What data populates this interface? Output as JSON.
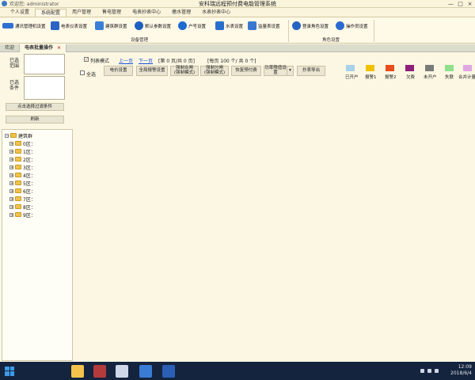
{
  "window": {
    "title": "安科瑞远程预付费电能管理系统",
    "welcome": "欢迎您: administrator",
    "controls": [
      "—",
      "□",
      "×"
    ]
  },
  "menu": {
    "tabs": [
      "个人设置",
      "系统配置",
      "用户管理",
      "售电管理",
      "电表抄表中心",
      "缴水管理",
      "水表抄表中心"
    ],
    "active_index": 1
  },
  "ribbon": {
    "items": [
      {
        "label": "通讯管理机设置",
        "icon": "gateway-icon",
        "color": "#2f6fd1"
      },
      {
        "label": "电表仪表设置",
        "icon": "meter-icon",
        "color": "#2a63c4"
      },
      {
        "label": "建筑群设置",
        "icon": "building-icon",
        "color": "#3b7fd6"
      },
      {
        "label": "默认参数设置",
        "icon": "gear-icon",
        "color": "#1f5fbf"
      },
      {
        "label": "户号设置",
        "icon": "household-icon",
        "color": "#1e6bd1"
      },
      {
        "label": "水表设置",
        "icon": "water-meter-icon",
        "color": "#2a6ecc"
      },
      {
        "label": "监量表设置",
        "icon": "monitor-icon",
        "color": "#3a78d0"
      },
      {
        "label": "登录角色设置",
        "icon": "user-role-icon",
        "color": "#2563c2"
      },
      {
        "label": "操作员设置",
        "icon": "operator-icon",
        "color": "#2b6bd0"
      }
    ],
    "groups": [
      "设备管理",
      "角色设置"
    ]
  },
  "filter_panel": {
    "selected_scope_label": "已选范围",
    "selected_conditions_label": "已选条件",
    "select_filter_button": "点击选择过滤条件",
    "refresh_button": "刷新"
  },
  "tree": {
    "root": "建筑群",
    "nodes": [
      "0区：",
      "1区：",
      "2区：",
      "3区：",
      "4区：",
      "5区：",
      "6区：",
      "7区：",
      "8区：",
      "9区："
    ]
  },
  "doc_tabs": [
    {
      "label": "欢迎"
    },
    {
      "label": "电表批量操作",
      "close": "×"
    }
  ],
  "toolbar": {
    "list_mode_label": "列表模式",
    "list_mode_checked": "✓",
    "select_all_label": "全选",
    "prev_page": "上一页",
    "next_page": "下一页",
    "page_info": "[第  0 页/共  0 页]",
    "page_size_info": "[每页 100 个/ 共          0 个]",
    "buttons": [
      "电价设置",
      "全局报警设置",
      "强制合闸\n(强制模式)",
      "强制分闸\n(强制模式)",
      "恢复预付费",
      "功率限值设\n置",
      "抄表导出"
    ],
    "dropdown_arrow": "▾"
  },
  "legend": [
    {
      "label": "已开户",
      "color": "#a9d0ea"
    },
    {
      "label": "报警1",
      "color": "#f2c200"
    },
    {
      "label": "报警2",
      "color": "#e84d1a"
    },
    {
      "label": "欠费",
      "color": "#8d1f7a"
    },
    {
      "label": "未开户",
      "color": "#7a7a7a"
    },
    {
      "label": "失联",
      "color": "#8fe08c"
    },
    {
      "label": "合并计量",
      "color": "#e0a6e2"
    }
  ],
  "taskbar": {
    "time": "12:09",
    "date": "2018/6/4",
    "apps": [
      {
        "name": "file-explorer-icon",
        "color": "#f3c34b"
      },
      {
        "name": "toolbox-icon",
        "color": "#b33b3b"
      },
      {
        "name": "window-app-icon",
        "color": "#cfd8e8"
      },
      {
        "name": "meter-app-icon",
        "color": "#3a7bd5"
      },
      {
        "name": "word-icon",
        "color": "#2b5fb6"
      }
    ]
  }
}
